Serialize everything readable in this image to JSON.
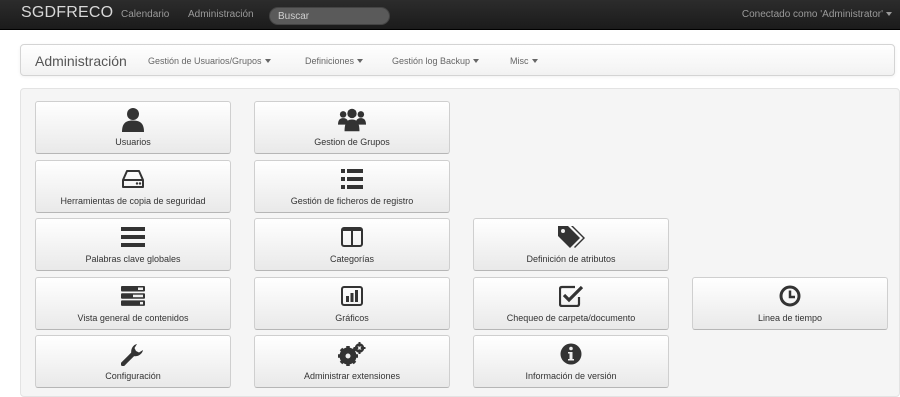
{
  "navbar": {
    "brand": "SGDFRECO",
    "links": [
      "Calendario",
      "Administración"
    ],
    "search_placeholder": "Buscar",
    "user_menu": "Conectado como 'Administrator'"
  },
  "subnav": {
    "title": "Administración",
    "menus": [
      "Gestión de Usuarios/Grupos",
      "Definiciones",
      "Gestión log Backup",
      "Misc"
    ]
  },
  "tiles": [
    {
      "label": "Usuarios",
      "icon": "user-icon"
    },
    {
      "label": "Gestion de Grupos",
      "icon": "group-icon"
    },
    {
      "label": "Herramientas de copia de seguridad",
      "icon": "hdd-icon"
    },
    {
      "label": "Gestión de ficheros de registro",
      "icon": "list-icon"
    },
    {
      "label": "Palabras clave globales",
      "icon": "reorder-icon"
    },
    {
      "label": "Categorías",
      "icon": "columns-icon"
    },
    {
      "label": "Definición de atributos",
      "icon": "tags-icon"
    },
    {
      "label": "Vista general de contenidos",
      "icon": "tasks-icon"
    },
    {
      "label": "Gráficos",
      "icon": "bar-chart-icon"
    },
    {
      "label": "Chequeo de carpeta/documento",
      "icon": "check-icon"
    },
    {
      "label": "Linea de tiempo",
      "icon": "clock-icon"
    },
    {
      "label": "Configuración",
      "icon": "wrench-icon"
    },
    {
      "label": "Administrar extensiones",
      "icon": "cogs-icon"
    },
    {
      "label": "Información de versión",
      "icon": "info-icon"
    }
  ],
  "colors": {
    "navbar_bg": "#1b1b1b",
    "panel_bg": "#f5f5f5",
    "icon": "#333333"
  }
}
